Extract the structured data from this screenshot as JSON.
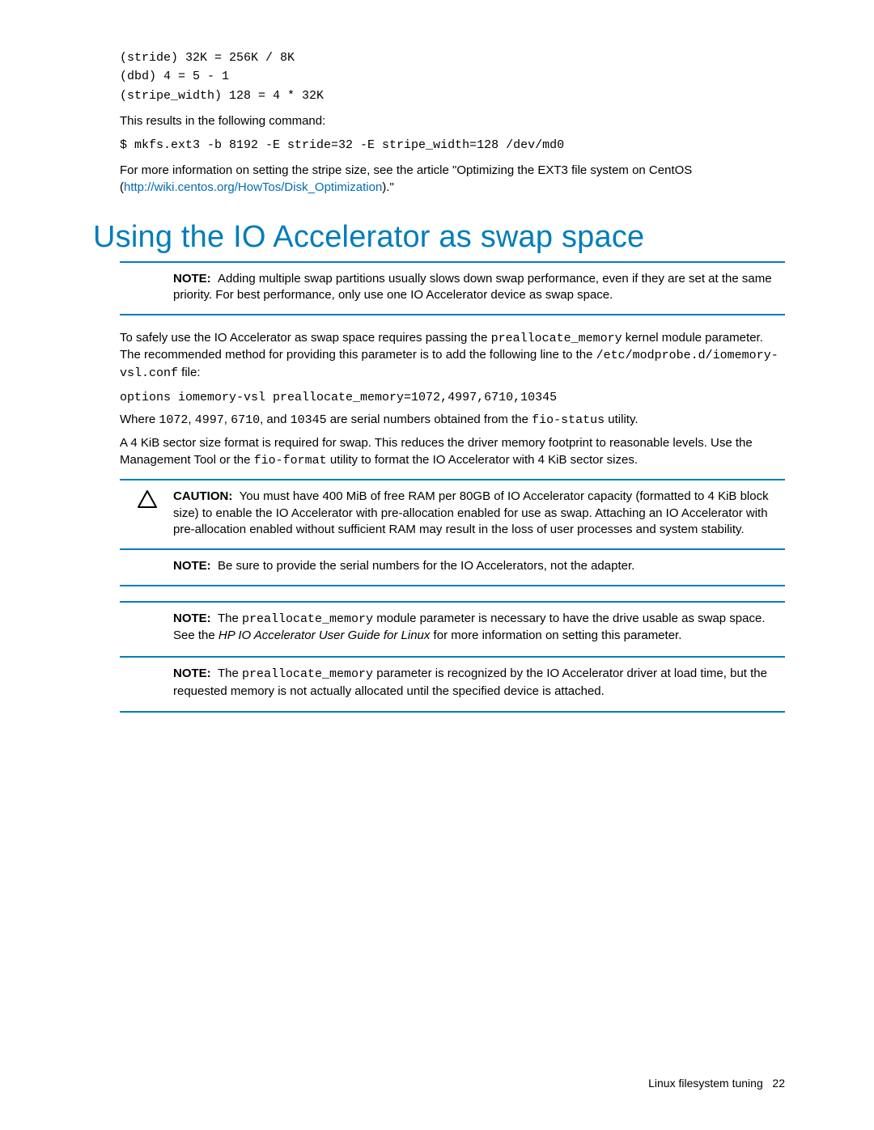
{
  "intro": {
    "code1": "(stride) 32K = 256K / 8K\n(dbd) 4 = 5 - 1\n(stripe_width) 128 = 4 * 32K",
    "text1": "This results in the following command:",
    "code2": "$ mkfs.ext3 -b 8192 -E stride=32 -E stripe_width=128 /dev/md0",
    "text2a": "For more information on setting the stripe size, see the article \"Optimizing the EXT3 file system on CentOS (",
    "link": "http://wiki.centos.org/HowTos/Disk_Optimization",
    "text2b": ").\""
  },
  "heading": "Using the IO Accelerator as swap space",
  "note1": {
    "label": "NOTE:",
    "text": "Adding multiple swap partitions usually slows down swap performance, even if they are set at the same priority. For best performance, only use one IO Accelerator device as swap space."
  },
  "para1": {
    "a": "To safely use the IO Accelerator as swap space requires passing the ",
    "code1": "preallocate_memory",
    "b": " kernel module parameter. The recommended method for providing this parameter is to add the following line to the ",
    "code2": "/etc/modprobe.d/iomemory-vsl.conf",
    "c": " file:"
  },
  "code3": "options iomemory-vsl preallocate_memory=1072,4997,6710,10345",
  "para2": {
    "a": "Where ",
    "code1": "1072",
    "b": ", ",
    "code2": "4997",
    "c": ", ",
    "code3": "6710",
    "d": ", and ",
    "code4": "10345",
    "e": " are serial numbers obtained from the ",
    "code5": "fio-status",
    "f": " utility."
  },
  "para3": {
    "a": "A 4 KiB sector size format is required for swap. This reduces the driver memory footprint to reasonable levels. Use the Management Tool or the ",
    "code1": "fio-format",
    "b": " utility to format the IO Accelerator with 4 KiB sector sizes."
  },
  "caution": {
    "label": "CAUTION:",
    "text": "You must have 400 MiB of free RAM per 80GB of IO Accelerator capacity (formatted to 4 KiB block size) to enable the IO Accelerator with pre-allocation enabled for use as swap. Attaching an IO Accelerator with pre-allocation enabled without sufficient RAM may result in the loss of user processes and system stability."
  },
  "note2": {
    "label": "NOTE:",
    "text": "Be sure to provide the serial numbers for the IO Accelerators, not the adapter."
  },
  "note3": {
    "label": "NOTE:",
    "a": "The ",
    "code": "preallocate_memory",
    "b": " module parameter is necessary to have the drive usable as swap space. See the ",
    "italic": "HP IO Accelerator User Guide for Linux",
    "c": " for more information on setting this parameter."
  },
  "note4": {
    "label": "NOTE:",
    "a": "The ",
    "code": "preallocate_memory",
    "b": " parameter is recognized by the IO Accelerator driver at load time, but the requested memory is not actually allocated until the specified device is attached."
  },
  "footer": {
    "title": "Linux filesystem tuning",
    "page": "22"
  }
}
